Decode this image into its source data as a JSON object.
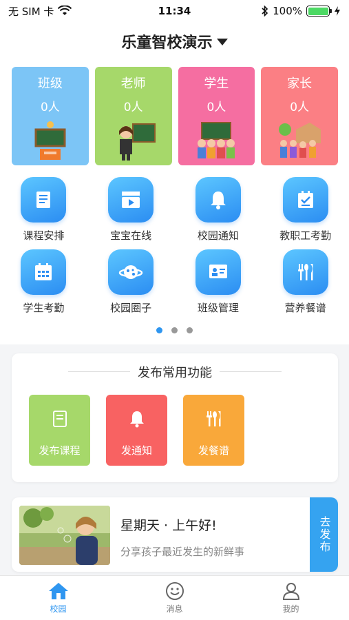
{
  "status_bar": {
    "carrier": "无 SIM 卡",
    "time": "11:34",
    "battery": "100%",
    "battery_level": 1.0
  },
  "header": {
    "title": "乐童智校演示"
  },
  "stats": [
    {
      "title": "班级",
      "count": "0人",
      "color": "#7cc5f6",
      "icon": "classroom-icon"
    },
    {
      "title": "老师",
      "count": "0人",
      "color": "#a6d86a",
      "icon": "teacher-icon"
    },
    {
      "title": "学生",
      "count": "0人",
      "color": "#f56ea1",
      "icon": "students-icon"
    },
    {
      "title": "家长",
      "count": "0人",
      "color": "#fb7f84",
      "icon": "parents-icon"
    }
  ],
  "grid": [
    {
      "label": "课程安排",
      "icon": "book-icon"
    },
    {
      "label": "宝宝在线",
      "icon": "video-icon"
    },
    {
      "label": "校园通知",
      "icon": "bell-icon"
    },
    {
      "label": "教职工考勤",
      "icon": "checklist-icon"
    },
    {
      "label": "学生考勤",
      "icon": "calendar-icon"
    },
    {
      "label": "校园圈子",
      "icon": "planet-icon"
    },
    {
      "label": "班级管理",
      "icon": "board-icon"
    },
    {
      "label": "营养餐谱",
      "icon": "cutlery-icon"
    }
  ],
  "publish": {
    "title": "发布常用功能",
    "items": [
      {
        "label": "发布课程",
        "color": "#a6d86a",
        "icon": "book-icon"
      },
      {
        "label": "发通知",
        "color": "#f86262",
        "icon": "bell-icon"
      },
      {
        "label": "发餐谱",
        "color": "#f9a83a",
        "icon": "cutlery-icon"
      }
    ]
  },
  "greeting": {
    "title": "星期天 · 上午好!",
    "subtitle": "分享孩子最近发生的新鲜事",
    "cta": "去发布"
  },
  "tabs": [
    {
      "label": "校园",
      "icon": "house-icon",
      "active": true
    },
    {
      "label": "消息",
      "icon": "smiley-icon",
      "active": false
    },
    {
      "label": "我的",
      "icon": "profile-icon",
      "active": false
    }
  ],
  "colors": {
    "accent": "#2f96f0"
  }
}
